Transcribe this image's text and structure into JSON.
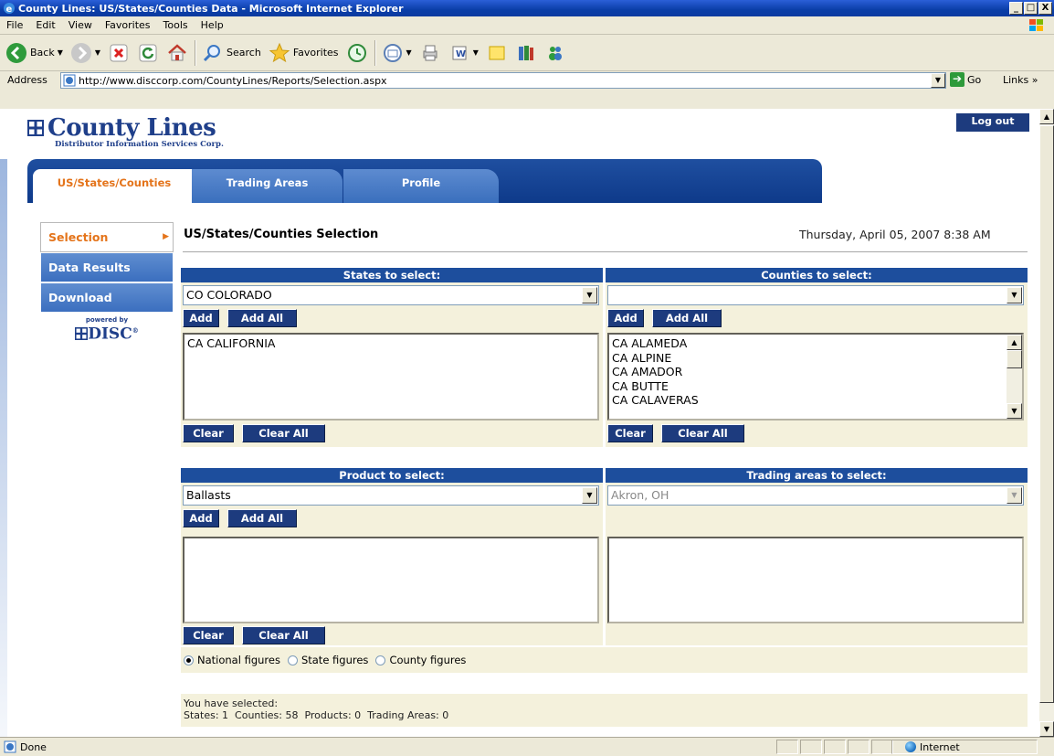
{
  "window": {
    "title": "County Lines: US/States/Counties Data - Microsoft Internet Explorer",
    "min": "_",
    "max": "□",
    "close": "X"
  },
  "menu": [
    "File",
    "Edit",
    "View",
    "Favorites",
    "Tools",
    "Help"
  ],
  "toolbar": {
    "back": "Back",
    "search": "Search",
    "favorites": "Favorites"
  },
  "address": {
    "label": "Address",
    "url": "http://www.disccorp.com/CountyLines/Reports/Selection.aspx",
    "go": "Go",
    "links": "Links"
  },
  "status": {
    "text": "Done",
    "zone": "Internet"
  },
  "header": {
    "logo": "County Lines",
    "logo_sub": "Distributor Information Services Corp.",
    "logout": "Log out"
  },
  "tabs": [
    {
      "label": "US/States/Counties",
      "active": true
    },
    {
      "label": "Trading Areas",
      "active": false
    },
    {
      "label": "Profile",
      "active": false
    }
  ],
  "sidenav": {
    "items": [
      {
        "label": "Selection",
        "active": true
      },
      {
        "label": "Data Results",
        "active": false
      },
      {
        "label": "Download",
        "active": false
      }
    ],
    "powered_by": "powered by",
    "powered_brand": "DISC"
  },
  "main": {
    "title": "US/States/Counties Selection",
    "date": "Thursday, April 05, 2007 8:38 AM"
  },
  "states": {
    "header": "States to select:",
    "selected": "CO COLORADO",
    "add": "Add",
    "add_all": "Add All",
    "list": [
      "CA CALIFORNIA"
    ],
    "clear": "Clear",
    "clear_all": "Clear All"
  },
  "counties": {
    "header": "Counties to select:",
    "selected": "",
    "add": "Add",
    "add_all": "Add All",
    "list": [
      "CA ALAMEDA",
      "CA ALPINE",
      "CA AMADOR",
      "CA BUTTE",
      "CA CALAVERAS"
    ],
    "clear": "Clear",
    "clear_all": "Clear All"
  },
  "products": {
    "header": "Product to select:",
    "selected": "Ballasts",
    "add": "Add",
    "add_all": "Add All",
    "clear": "Clear",
    "clear_all": "Clear All"
  },
  "trading": {
    "header": "Trading areas to select:",
    "selected": "Akron, OH"
  },
  "figures": {
    "options": [
      "National figures",
      "State figures",
      "County figures"
    ],
    "selected_index": 0
  },
  "summary": {
    "line1": "You have selected:",
    "line2": "States: 1  Counties: 58  Products: 0  Trading Areas: 0"
  },
  "colors": {
    "accent_orange": "#e4741b",
    "header_blue": "#1d4e9d",
    "button_navy": "#1d3b7e",
    "panel_beige": "#f4f1dc"
  }
}
